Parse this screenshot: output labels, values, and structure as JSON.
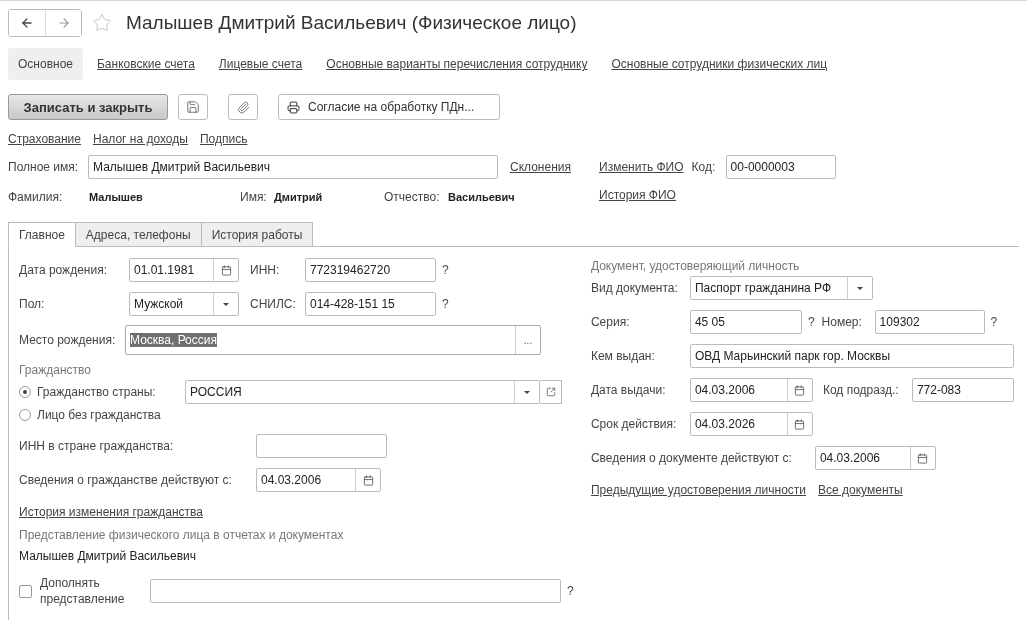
{
  "title": "Малышев Дмитрий Васильевич (Физическое лицо)",
  "favorite": false,
  "sections": [
    {
      "label": "Основное",
      "selected": true
    },
    {
      "label": "Банковские счета",
      "selected": false
    },
    {
      "label": "Лицевые счета",
      "selected": false
    },
    {
      "label": "Основные варианты перечисления сотруднику",
      "selected": false
    },
    {
      "label": "Основные сотрудники физических лиц",
      "selected": false
    }
  ],
  "toolbar": {
    "primary": "Записать и закрыть",
    "print": "Согласие на обработку ПДн..."
  },
  "links": [
    "Страхование",
    "Налог на доходы",
    "Подпись"
  ],
  "full_name": {
    "label": "Полное имя:",
    "value": "Малышев Дмитрий Васильевич",
    "link": "Склонения"
  },
  "change_name_link": "Изменить ФИО",
  "code": {
    "label": "Код:",
    "value": "00-0000003"
  },
  "name_history_link": "История ФИО",
  "name_parts": [
    {
      "label": "Фамилия:",
      "value": "Малышев"
    },
    {
      "label": "Имя:",
      "value": "Дмитрий"
    },
    {
      "label": "Отчество:",
      "value": "Васильевич"
    }
  ],
  "tabs": [
    {
      "label": "Главное",
      "selected": true
    },
    {
      "label": "Адреса, телефоны",
      "selected": false
    },
    {
      "label": "История работы",
      "selected": false
    }
  ],
  "birth_date": {
    "label": "Дата рождения:",
    "value": "01.01.1981"
  },
  "inn": {
    "label": "ИНН:",
    "value": "772319462720",
    "hint": "?"
  },
  "gender": {
    "label": "Пол:",
    "value": "Мужской"
  },
  "snils": {
    "label": "СНИЛС:",
    "value": "014-428-151 15",
    "hint": "?"
  },
  "birth_place": {
    "label": "Место рождения:",
    "value": "Москва, Россия",
    "text_selected": true,
    "button": "..."
  },
  "citizenship": {
    "caption": "Гражданство",
    "country": "РОССИЯ",
    "options": [
      {
        "label": "Гражданство страны:",
        "selected": true
      },
      {
        "label": "Лицо без гражданства",
        "selected": false
      }
    ]
  },
  "foreign_inn": {
    "label": "ИНН в стране гражданства:"
  },
  "citizenship_since": {
    "label": "Сведения о гражданстве действуют с:",
    "value": "04.03.2006"
  },
  "citizenship_history_link": "История изменения гражданства",
  "presentation": {
    "caption": "Представление физического лица в отчетах и документах",
    "value": "Малышев Дмитрий Васильевич",
    "extend_label": "Дополнять представление",
    "extend_checked": false,
    "hint": "?"
  },
  "document": {
    "caption": "Документ, удостоверяющий личность",
    "type": {
      "label": "Вид документа:",
      "value": "Паспорт гражданина РФ"
    },
    "series": {
      "label": "Серия:",
      "value": "45 05",
      "hint": "?"
    },
    "number": {
      "label": "Номер:",
      "value": "109302",
      "hint": "?"
    },
    "issued_by": {
      "label": "Кем выдан:",
      "value": "ОВД Марьинский парк гор. Москвы"
    },
    "issue_date": {
      "label": "Дата выдачи:",
      "value": "04.03.2006"
    },
    "unit_code": {
      "label": "Код подразд.:",
      "value": "772-083"
    },
    "valid_until": {
      "label": "Срок действия:",
      "value": "04.03.2026"
    },
    "valid_since": {
      "label": "Сведения о документе действуют с:",
      "value": "04.03.2006"
    },
    "links": [
      "Предыдущие удостоверения личности",
      "Все документы"
    ]
  }
}
